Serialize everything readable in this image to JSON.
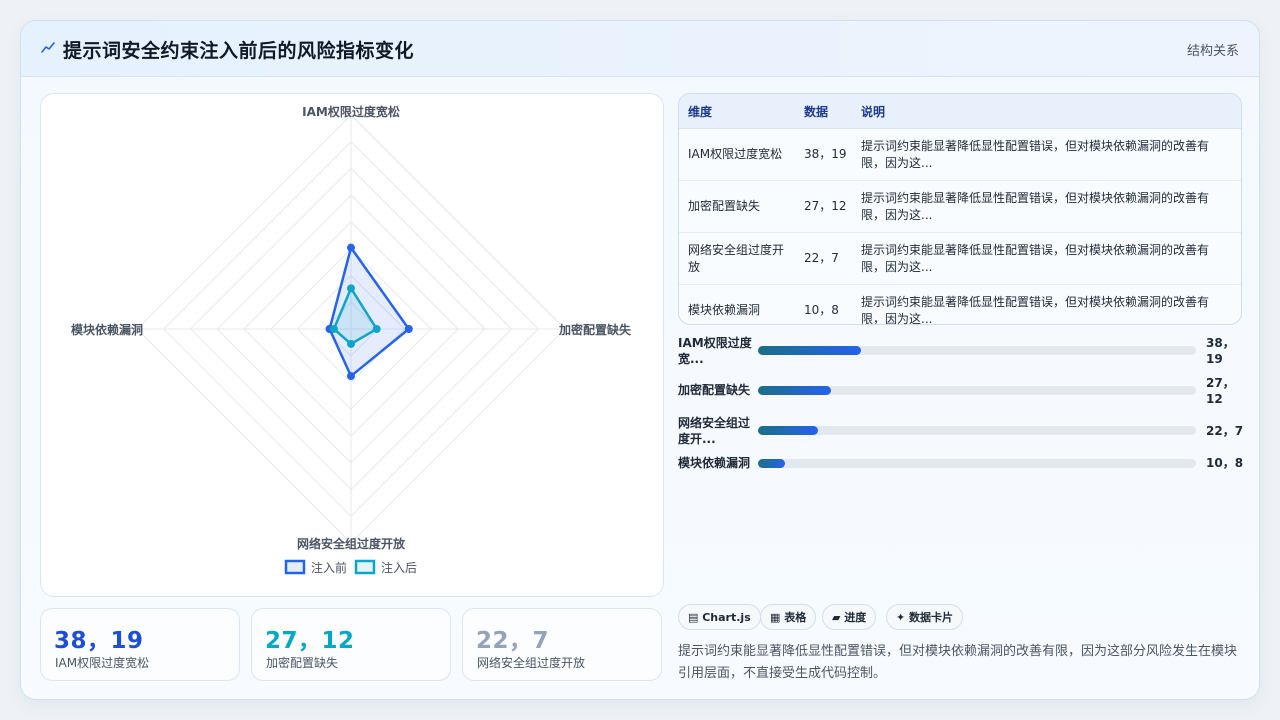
{
  "header": {
    "title": "提示词安全约束注入前后的风险指标变化",
    "link": "结构关系"
  },
  "chart_data": {
    "type": "radar",
    "axes": [
      "IAM权限过度宽松",
      "加密配置缺失",
      "网络安全组过度开放",
      "模块依赖漏洞"
    ],
    "series": [
      {
        "name": "注入前",
        "values": [
          38,
          27,
          22,
          10
        ],
        "color": "#2563eb"
      },
      {
        "name": "注入后",
        "values": [
          19,
          12,
          7,
          8
        ],
        "color": "#0ea5c6"
      }
    ],
    "rmax": 100,
    "grid_levels": 8,
    "legend_position": "bottom"
  },
  "stats": [
    {
      "value": "38，19",
      "label": "IAM权限过度宽松",
      "color": "#1d4ed8"
    },
    {
      "value": "27，12",
      "label": "加密配置缺失",
      "color": "#06a7c2"
    },
    {
      "value": "22，7",
      "label": "网络安全组过度开放",
      "color": "#94a3b8"
    }
  ],
  "table": {
    "headers": [
      "维度",
      "数据",
      "说明"
    ],
    "rows": [
      {
        "dim": "IAM权限过度宽松",
        "data": "38，19",
        "desc": "提示词约束能显著降低显性配置错误，但对模块依赖漏洞的改善有限，因为这..."
      },
      {
        "dim": "加密配置缺失",
        "data": "27，12",
        "desc": "提示词约束能显著降低显性配置错误，但对模块依赖漏洞的改善有限，因为这..."
      },
      {
        "dim": "网络安全组过度开放",
        "data": "22，7",
        "desc": "提示词约束能显著降低显性配置错误，但对模块依赖漏洞的改善有限，因为这..."
      },
      {
        "dim": "模块依赖漏洞",
        "data": "10，8",
        "desc": "提示词约束能显著降低显性配置错误，但对模块依赖漏洞的改善有限，因为这..."
      }
    ]
  },
  "progress": [
    {
      "label": "IAM权限过度宽...",
      "value": "38，19",
      "fraction": 0.235
    },
    {
      "label": "加密配置缺失",
      "value": "27，12",
      "fraction": 0.167
    },
    {
      "label": "网络安全组过度开...",
      "value": "22，7",
      "fraction": 0.136
    },
    {
      "label": "模块依赖漏洞",
      "value": "10，8",
      "fraction": 0.062
    }
  ],
  "chips": [
    {
      "icon": "chart-icon",
      "label": "Chart.js"
    },
    {
      "icon": "table-icon",
      "label": "表格"
    },
    {
      "icon": "progress-icon",
      "label": "进度"
    },
    {
      "icon": "sparkle-icon",
      "label": "数据卡片"
    }
  ],
  "note": "提示词约束能显著降低显性配置错误，但对模块依赖漏洞的改善有限，因为这部分风险发生在模块引用层面，不直接受生成代码控制。"
}
